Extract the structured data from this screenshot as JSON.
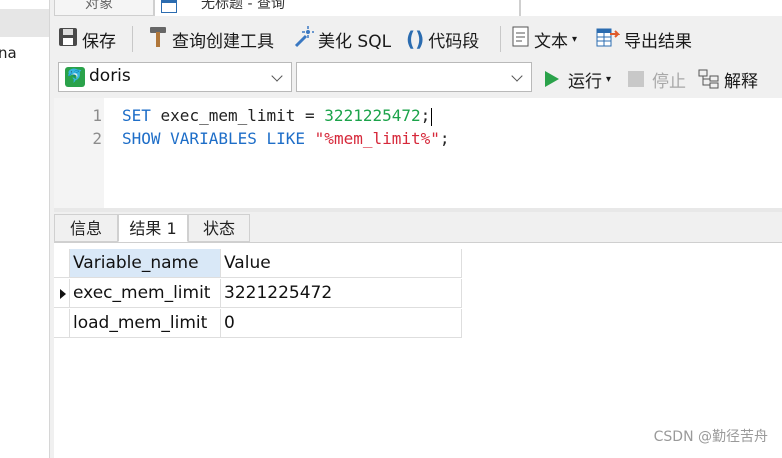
{
  "left_panel": {
    "visible_text": "na"
  },
  "tabs": {
    "objects_label": "对象",
    "query_label": "无标题 - 查询"
  },
  "toolbar": {
    "save": "保存",
    "query_builder": "查询创建工具",
    "beautify": "美化 SQL",
    "snippet": "代码段",
    "text": "文本",
    "export": "导出结果"
  },
  "connection": {
    "selected": "doris",
    "database": ""
  },
  "run_controls": {
    "run": "运行",
    "stop": "停止",
    "explain": "解释"
  },
  "editor": {
    "line_numbers": [
      "1",
      "2"
    ],
    "line1": {
      "kw": "SET",
      "ident": " exec_mem_limit = ",
      "num": "3221225472",
      "end": ";"
    },
    "line2": {
      "kw": "SHOW VARIABLES LIKE",
      "str": "\"%mem_limit%\"",
      "end": ";"
    }
  },
  "result_tabs": [
    "信息",
    "结果 1",
    "状态"
  ],
  "result_grid": {
    "columns": [
      "Variable_name",
      "Value"
    ],
    "rows": [
      [
        "exec_mem_limit",
        "3221225472"
      ],
      [
        "load_mem_limit",
        "0"
      ]
    ]
  },
  "watermark": "CSDN @勤径苦舟",
  "colors": {
    "keyword": "#1e6ec8",
    "number": "#1ba34a",
    "string": "#d6283a",
    "header_selected": "#d9e8f7",
    "run_green": "#2aa24a"
  }
}
